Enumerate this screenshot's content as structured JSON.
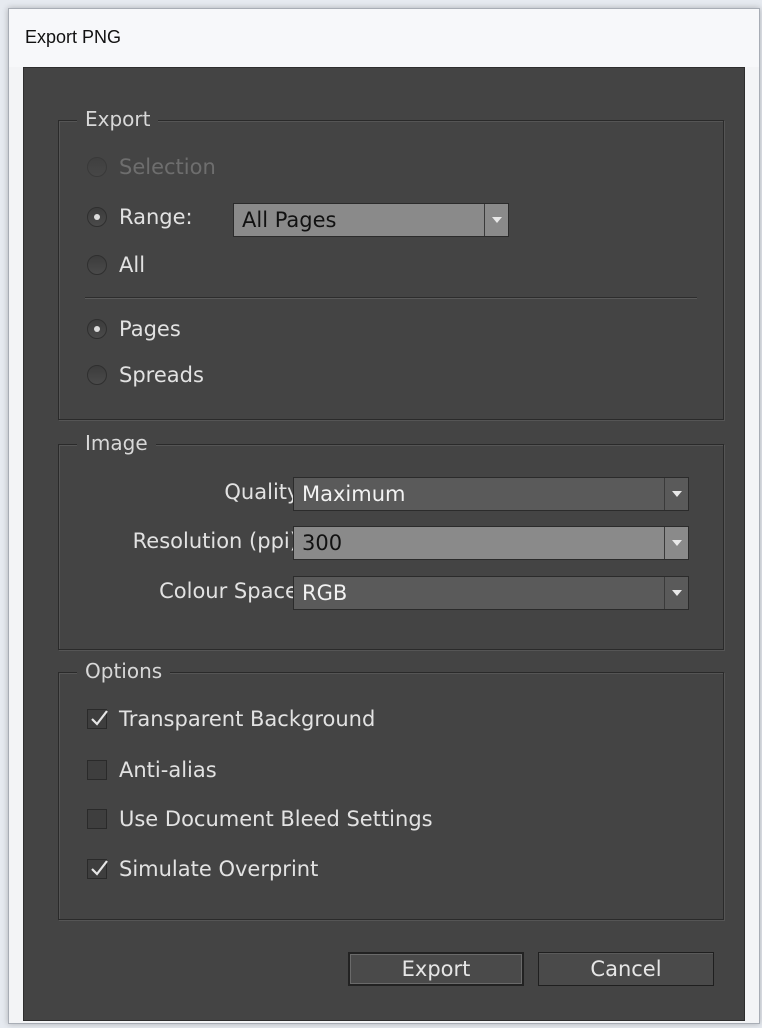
{
  "window": {
    "title": "Export PNG"
  },
  "export_group": {
    "legend": "Export",
    "selection_label": "Selection",
    "range_label": "Range:",
    "range_value": "All Pages",
    "all_label": "All",
    "pages_label": "Pages",
    "spreads_label": "Spreads"
  },
  "image_group": {
    "legend": "Image",
    "quality_label": "Quality:",
    "quality_value": "Maximum",
    "resolution_label": "Resolution (ppi):",
    "resolution_value": "300",
    "colour_space_label": "Colour Space:",
    "colour_space_value": "RGB"
  },
  "options_group": {
    "legend": "Options",
    "items": [
      {
        "label": "Transparent Background",
        "checked": true
      },
      {
        "label": "Anti-alias",
        "checked": false
      },
      {
        "label": "Use Document Bleed Settings",
        "checked": false
      },
      {
        "label": "Simulate Overprint",
        "checked": true
      }
    ]
  },
  "buttons": {
    "export": "Export",
    "cancel": "Cancel"
  }
}
